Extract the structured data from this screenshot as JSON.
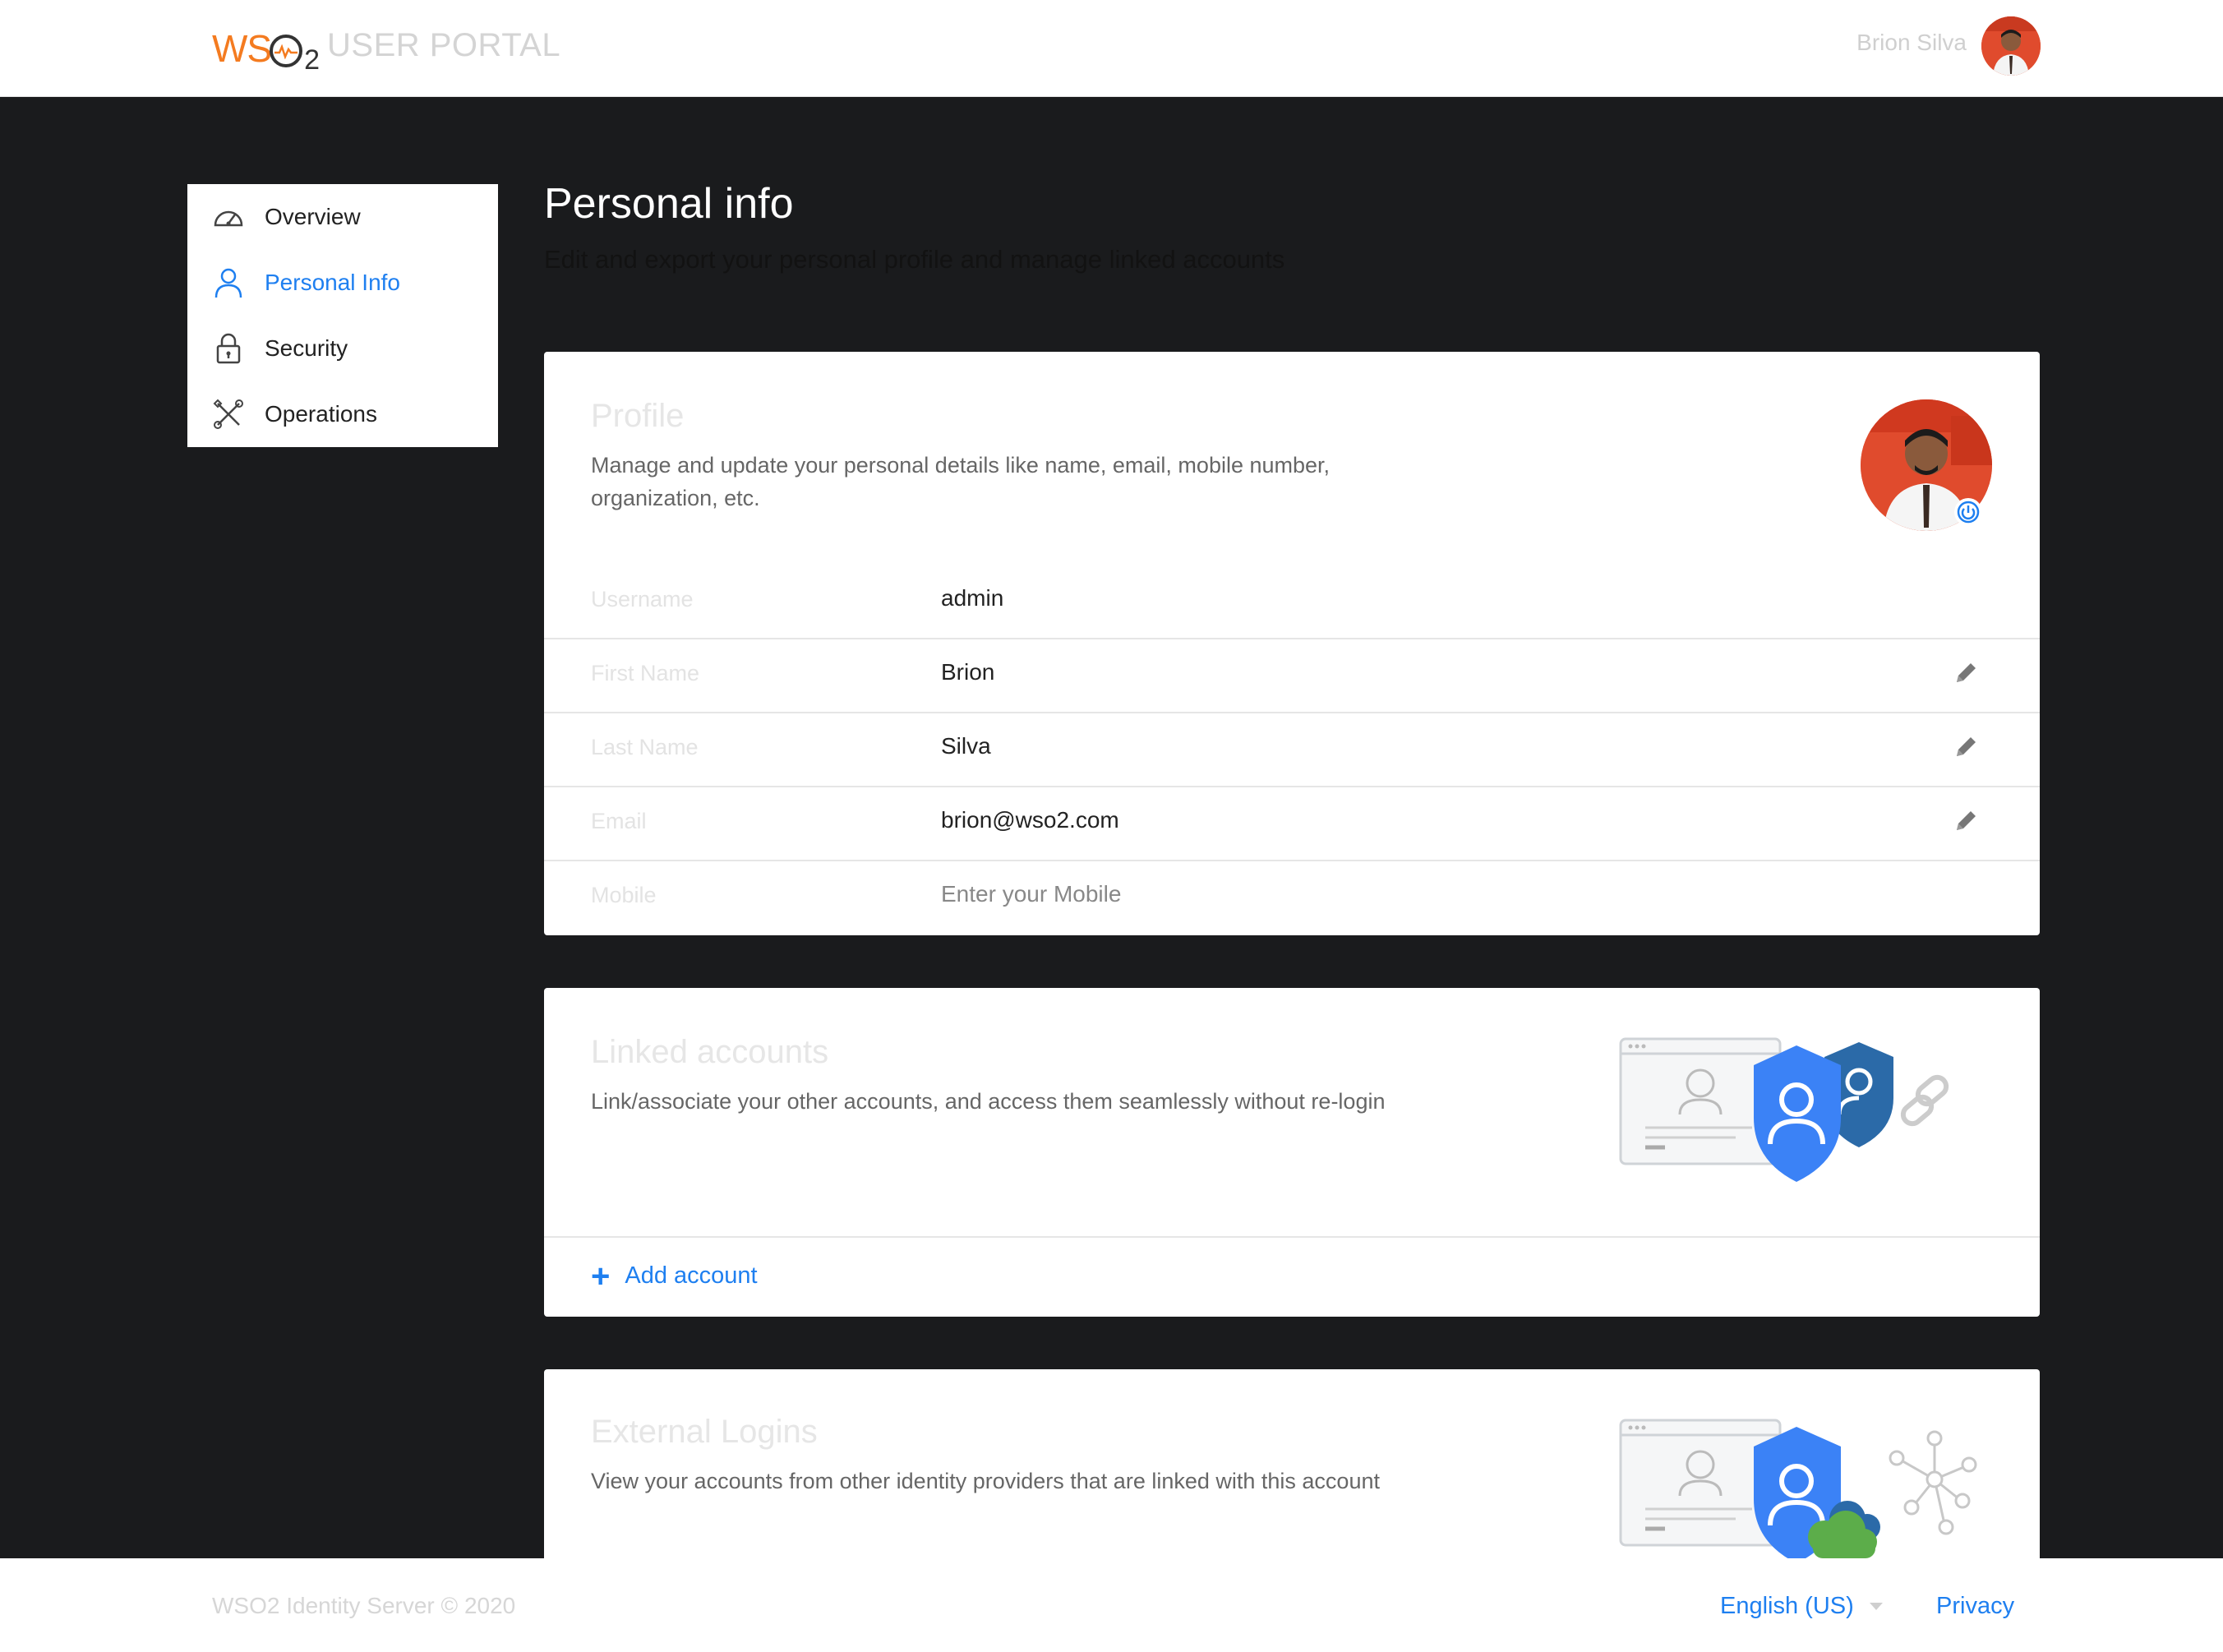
{
  "header": {
    "logo_text": "WSO2",
    "app_title": "USER PORTAL",
    "user_name": "Brion Silva"
  },
  "sidebar": {
    "items": [
      {
        "label": "Overview",
        "icon": "gauge-icon",
        "active": false
      },
      {
        "label": "Personal Info",
        "icon": "user-icon",
        "active": true
      },
      {
        "label": "Security",
        "icon": "lock-icon",
        "active": false
      },
      {
        "label": "Operations",
        "icon": "tools-icon",
        "active": false
      }
    ]
  },
  "page": {
    "title": "Personal info",
    "subtitle": "Edit and export your personal profile and manage linked accounts"
  },
  "profile": {
    "title": "Profile",
    "description": "Manage and update your personal details like name, email, mobile number, organization, etc.",
    "fields": [
      {
        "label": "Username",
        "value": "admin",
        "editable": false,
        "placeholder": false
      },
      {
        "label": "First Name",
        "value": "Brion",
        "editable": true,
        "placeholder": false
      },
      {
        "label": "Last Name",
        "value": "Silva",
        "editable": true,
        "placeholder": false
      },
      {
        "label": "Email",
        "value": "brion@wso2.com",
        "editable": true,
        "placeholder": false
      },
      {
        "label": "Mobile",
        "value": "Enter your Mobile",
        "editable": false,
        "placeholder": true
      }
    ]
  },
  "linked_accounts": {
    "title": "Linked accounts",
    "description": "Link/associate your other accounts, and access them seamlessly without re-login",
    "add_label": "Add account"
  },
  "external_logins": {
    "title": "External Logins",
    "description": "View your accounts from other identity providers that are linked with this account"
  },
  "footer": {
    "copyright": "WSO2 Identity Server © 2020",
    "language": "English (US)",
    "privacy": "Privacy"
  },
  "colors": {
    "accent": "#1e7ff0",
    "brand_orange": "#f47b20",
    "background": "#1a1b1d"
  }
}
